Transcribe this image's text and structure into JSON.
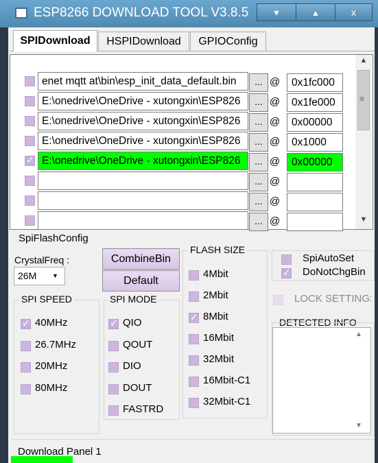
{
  "window": {
    "title": "ESP8266 DOWNLOAD TOOL V3.8.5",
    "min_icon": "▾",
    "max_icon": "▴",
    "close_icon": "x"
  },
  "tabs": [
    "SPIDownload",
    "HSPIDownload",
    "GPIOConfig"
  ],
  "files": [
    {
      "checked": false,
      "path": "enet mqtt at\\bin\\esp_init_data_default.bin",
      "addr": "0x1fc000",
      "highlight": false
    },
    {
      "checked": false,
      "path": "E:\\onedrive\\OneDrive - xutongxin\\ESP826",
      "addr": "0x1fe000",
      "highlight": false
    },
    {
      "checked": false,
      "path": "E:\\onedrive\\OneDrive - xutongxin\\ESP826",
      "addr": "0x00000",
      "highlight": false
    },
    {
      "checked": false,
      "path": "E:\\onedrive\\OneDrive - xutongxin\\ESP826",
      "addr": "0x1000",
      "highlight": false
    },
    {
      "checked": true,
      "path": "E:\\onedrive\\OneDrive - xutongxin\\ESP826",
      "addr": "0x00000",
      "highlight": true
    },
    {
      "checked": false,
      "path": "",
      "addr": "",
      "highlight": false
    },
    {
      "checked": false,
      "path": "",
      "addr": "",
      "highlight": false
    },
    {
      "checked": false,
      "path": "",
      "addr": "",
      "highlight": false
    }
  ],
  "browse_label": "...",
  "at_sign": "@",
  "config": {
    "section_title": "SpiFlashConfig",
    "crystal_label": "CrystalFreq :",
    "crystal_value": "26M",
    "combine_label": "CombineBin",
    "default_label": "Default",
    "spi_speed": {
      "title": "SPI SPEED",
      "options": [
        {
          "label": "40MHz",
          "checked": true
        },
        {
          "label": "26.7MHz",
          "checked": false
        },
        {
          "label": "20MHz",
          "checked": false
        },
        {
          "label": "80MHz",
          "checked": false
        }
      ]
    },
    "spi_mode": {
      "title": "SPI MODE",
      "options": [
        {
          "label": "QIO",
          "checked": true
        },
        {
          "label": "QOUT",
          "checked": false
        },
        {
          "label": "DIO",
          "checked": false
        },
        {
          "label": "DOUT",
          "checked": false
        },
        {
          "label": "FASTRD",
          "checked": false
        }
      ]
    },
    "flash_size": {
      "title": "FLASH SIZE",
      "options": [
        {
          "label": "4Mbit",
          "checked": false
        },
        {
          "label": "2Mbit",
          "checked": false
        },
        {
          "label": "8Mbit",
          "checked": true
        },
        {
          "label": "16Mbit",
          "checked": false
        },
        {
          "label": "32Mbit",
          "checked": false
        },
        {
          "label": "16Mbit-C1",
          "checked": false
        },
        {
          "label": "32Mbit-C1",
          "checked": false
        }
      ]
    },
    "spi_auto_set": {
      "label": "SpiAutoSet",
      "checked": false
    },
    "do_not_chg_bin": {
      "label": "DoNotChgBin",
      "checked": true
    },
    "lock_settings": {
      "label": "LOCK SETTINGS",
      "checked": false
    },
    "detected_info_title": "DETECTED INFO"
  },
  "download_panel_label": "Download Panel 1",
  "progress_fraction": 0.17,
  "colors": {
    "highlight": "#00ff00",
    "checkbox": "#cdb6dd",
    "titlebar": "#5a94bd"
  }
}
